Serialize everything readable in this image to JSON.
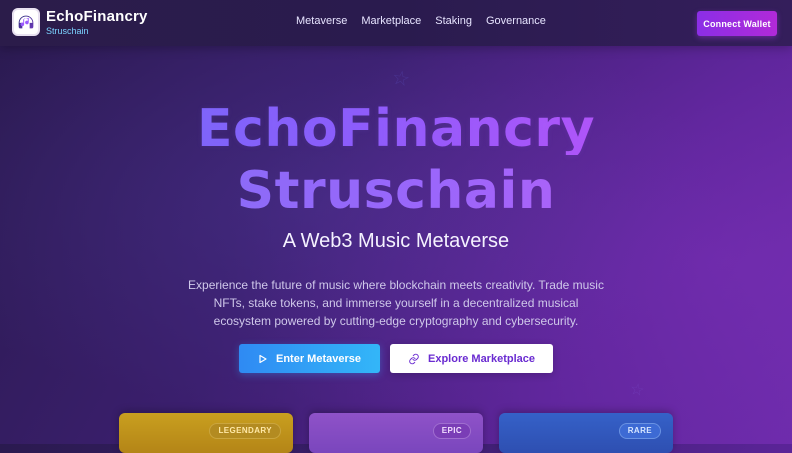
{
  "brand": {
    "title": "EchoFinancry",
    "subtitle": "Struschain",
    "logo_icon": "headphones-note-icon"
  },
  "nav": {
    "items": [
      "Metaverse",
      "Marketplace",
      "Staking",
      "Governance"
    ]
  },
  "header": {
    "connect_label": "Connect Wallet",
    "colors": {
      "accent": "#9b30e6"
    }
  },
  "hero": {
    "title_line_1": "EchoFinancry",
    "title_line_2": "Struschain",
    "subtitle": "A Web3 Music Metaverse",
    "description": "Experience the future of music where blockchain meets creativity. Trade music NFTs, stake tokens, and immerse yourself in a decentralized musical ecosystem powered by cutting-edge cryptography and cybersecurity."
  },
  "cta": {
    "enter": {
      "label": "Enter Metaverse",
      "icon": "play-icon"
    },
    "explore": {
      "label": "Explore Marketplace",
      "icon": "link-icon"
    }
  },
  "cards": [
    {
      "badge": "LEGENDARY",
      "color": "#c99f1f"
    },
    {
      "badge": "EPIC",
      "color": "#8f52c8"
    },
    {
      "badge": "RARE",
      "color": "#3561c8"
    }
  ],
  "decorations": {
    "stars": [
      "star-outline-icon",
      "star-outline-icon"
    ]
  }
}
